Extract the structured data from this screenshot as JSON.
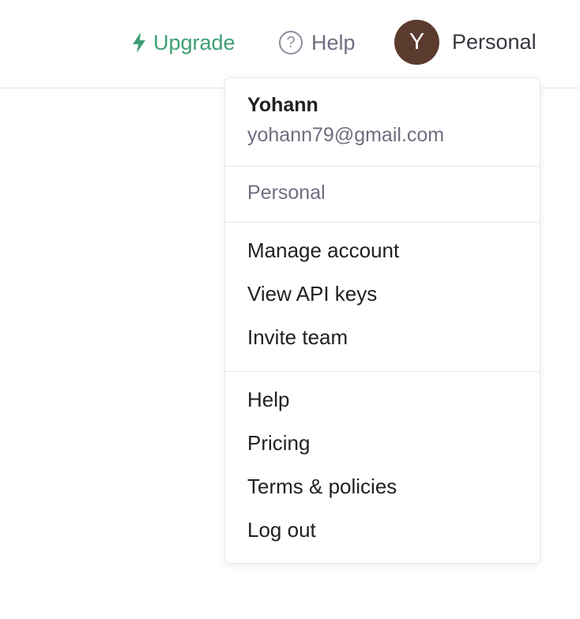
{
  "header": {
    "upgrade_label": "Upgrade",
    "upgrade_icon": "lightning-bolt-icon",
    "help_label": "Help",
    "help_icon": "question-circle-icon",
    "help_glyph": "?",
    "avatar_initial": "Y",
    "account_label": "Personal"
  },
  "menu": {
    "user": {
      "name": "Yohann",
      "email": "yohann79@gmail.com"
    },
    "organization": "Personal",
    "account_items": [
      {
        "label": "Manage account"
      },
      {
        "label": "View API keys"
      },
      {
        "label": "Invite team"
      }
    ],
    "general_items": [
      {
        "label": "Help"
      },
      {
        "label": "Pricing"
      },
      {
        "label": "Terms & policies"
      },
      {
        "label": "Log out"
      }
    ]
  },
  "colors": {
    "accent_green": "#3e9f74",
    "avatar_bg": "#5b3b2e",
    "muted_text": "#6e6e80",
    "divider": "#e6e6e9"
  }
}
